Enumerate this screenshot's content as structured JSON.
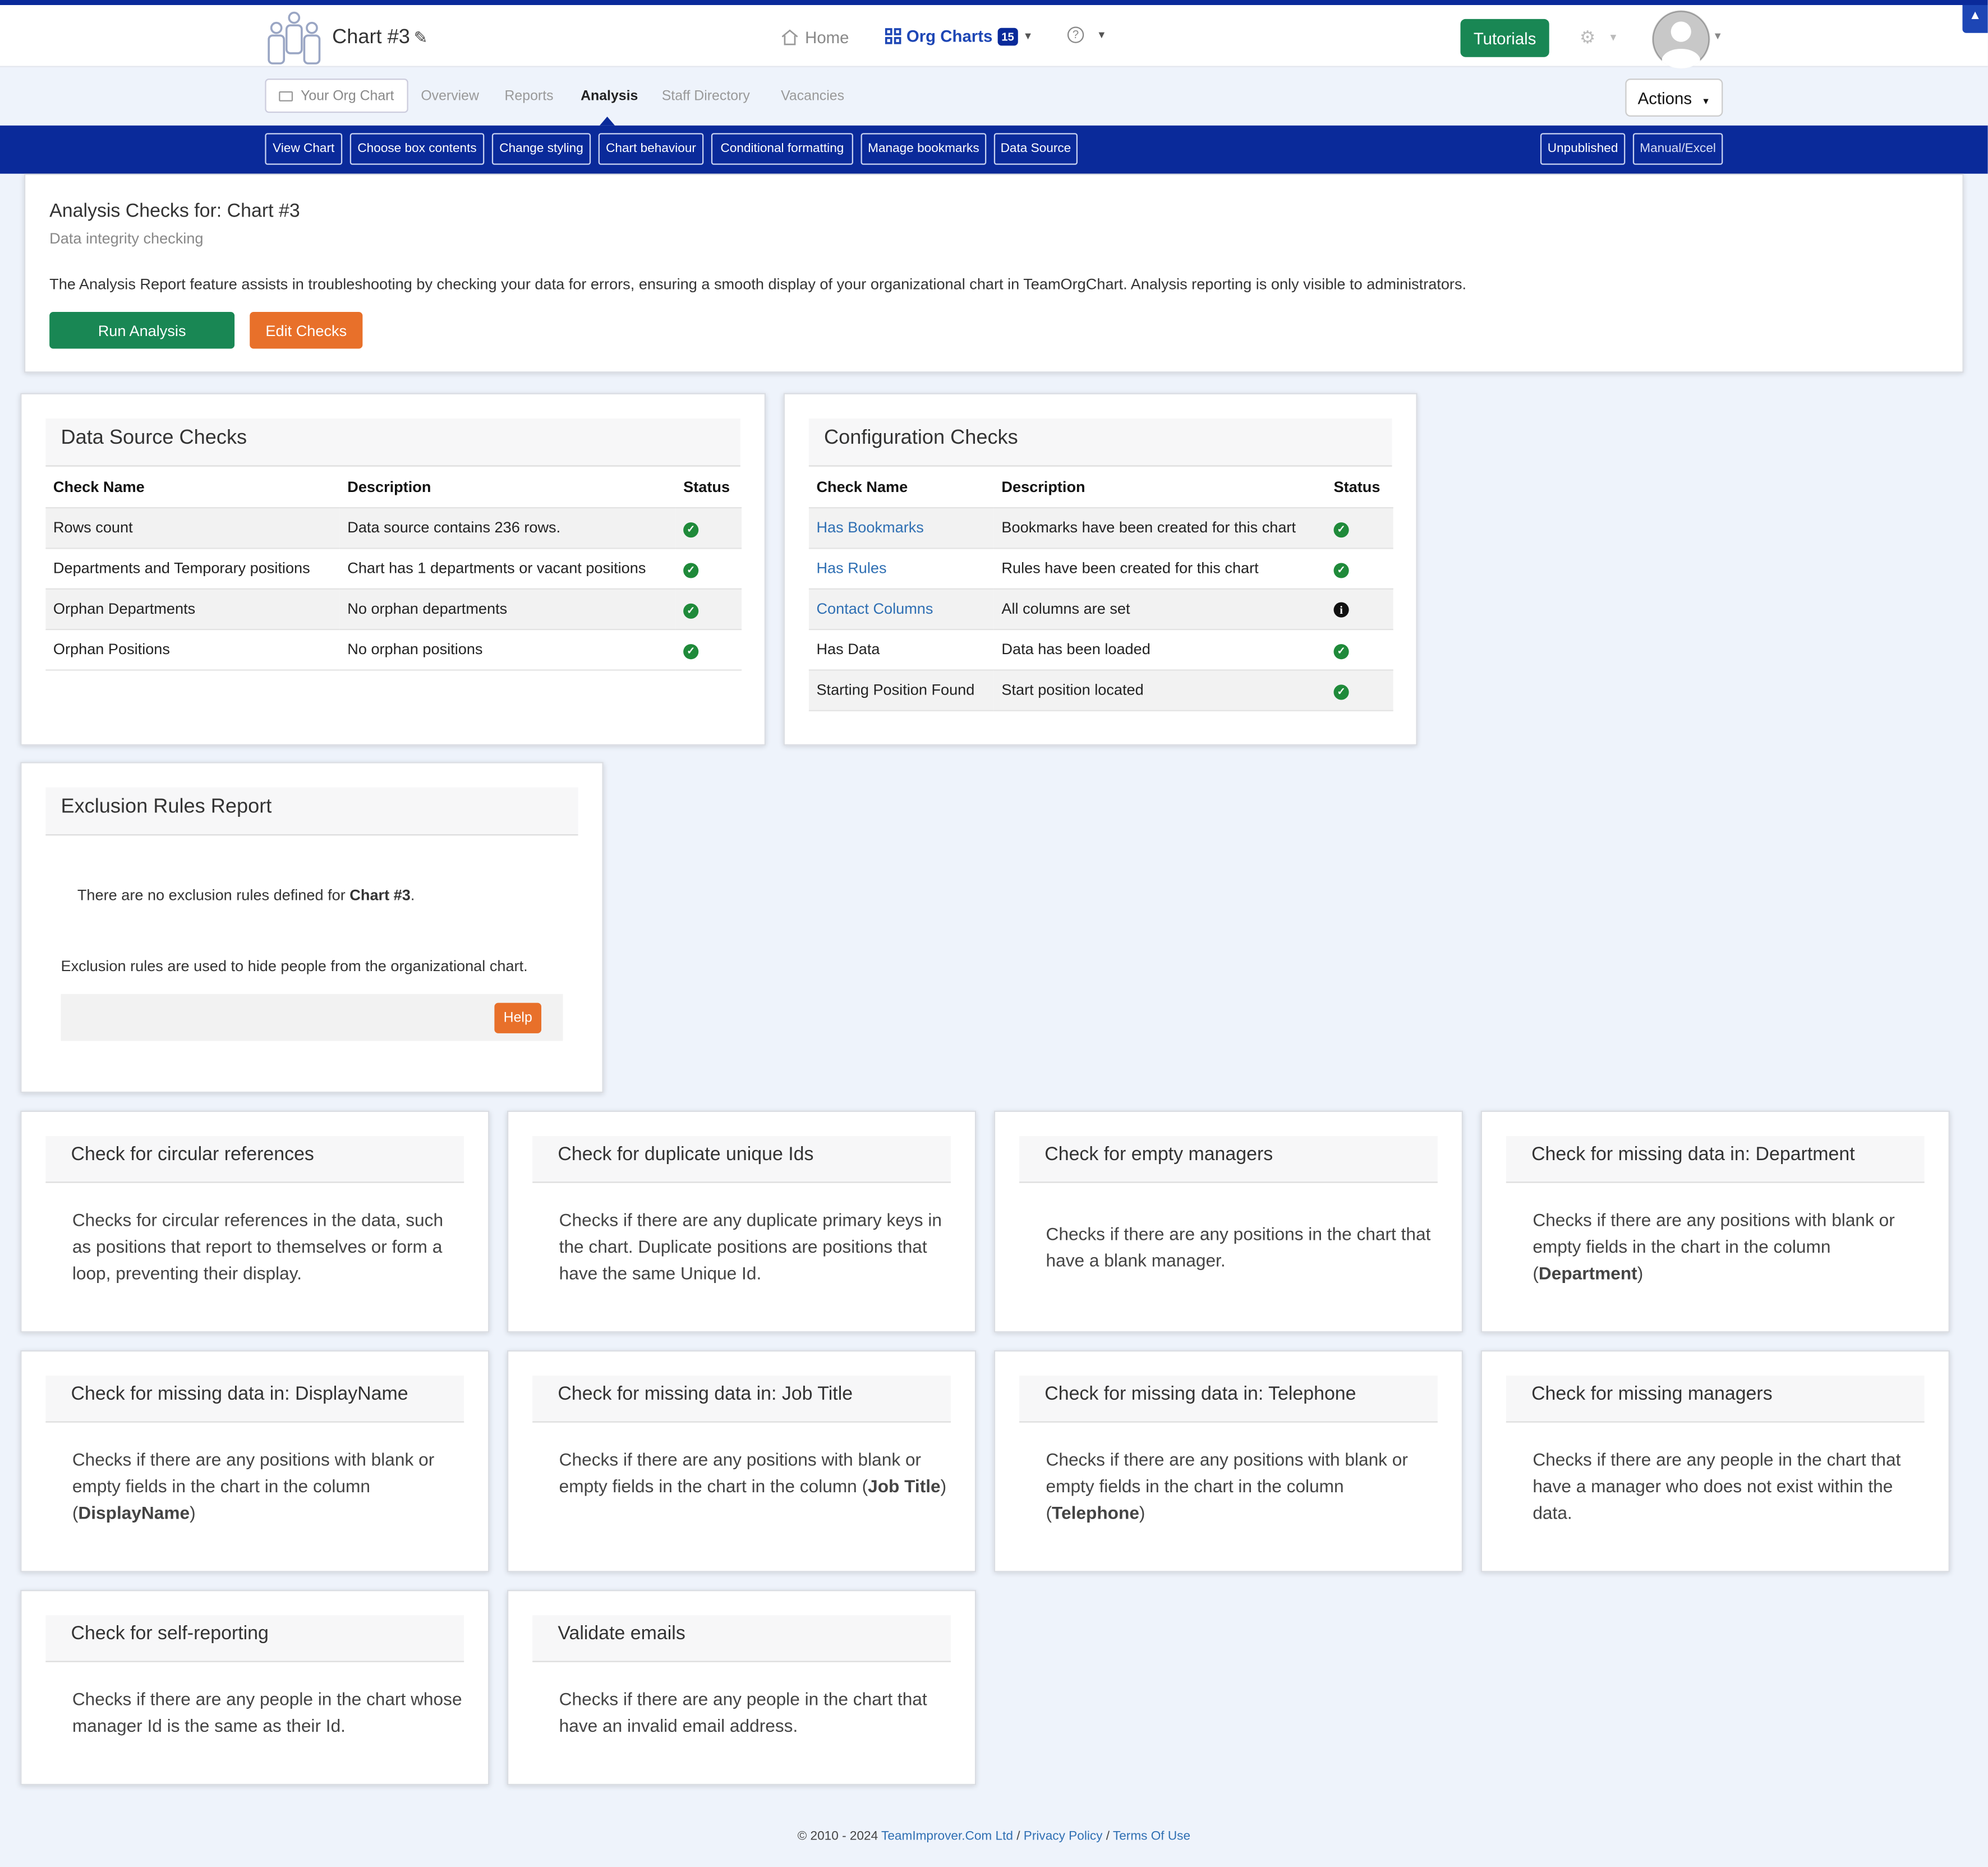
{
  "header": {
    "chart_title": "Chart #3",
    "nav": {
      "home": "Home",
      "org_charts": "Org Charts",
      "org_charts_count": "15"
    },
    "tutorials_label": "Tutorials"
  },
  "tabs": {
    "your_org_chart": "Your Org Chart",
    "items": [
      "Overview",
      "Reports",
      "Analysis",
      "Staff Directory",
      "Vacancies"
    ],
    "active": "Analysis",
    "actions_label": "Actions"
  },
  "toolbar": {
    "buttons": [
      "View Chart",
      "Choose box contents",
      "Change styling",
      "Chart behaviour",
      "Conditional formatting",
      "Manage bookmarks",
      "Data Source"
    ],
    "right_buttons": [
      "Unpublished",
      "Manual/Excel"
    ]
  },
  "intro": {
    "title": "Analysis Checks for: Chart #3",
    "subtitle": "Data integrity checking",
    "description": "The Analysis Report feature assists in troubleshooting by checking your data for errors, ensuring a smooth display of your organizational chart in TeamOrgChart. Analysis reporting is only visible to administrators.",
    "run_label": "Run Analysis",
    "edit_label": "Edit Checks"
  },
  "data_source": {
    "title": "Data Source Checks",
    "headers": [
      "Check Name",
      "Description",
      "Status"
    ],
    "rows": [
      {
        "name": "Rows count",
        "description": "Data source contains 236 rows.",
        "status": "ok"
      },
      {
        "name": "Departments and Temporary positions",
        "description": "Chart has 1 departments or vacant positions",
        "status": "ok"
      },
      {
        "name": "Orphan Departments",
        "description": "No orphan departments",
        "status": "ok"
      },
      {
        "name": "Orphan Positions",
        "description": "No orphan positions",
        "status": "ok"
      }
    ]
  },
  "configuration": {
    "title": "Configuration Checks",
    "headers": [
      "Check Name",
      "Description",
      "Status"
    ],
    "rows": [
      {
        "name": "Has Bookmarks",
        "description": "Bookmarks have been created for this chart",
        "status": "ok"
      },
      {
        "name": "Has Rules",
        "description": "Rules have been created for this chart",
        "status": "ok"
      },
      {
        "name": "Contact Columns",
        "description": "All columns are set",
        "status": "info"
      },
      {
        "name": "Has Data",
        "description": "Data has been loaded",
        "status": "ok"
      },
      {
        "name": "Starting Position Found",
        "description": "Start position located",
        "status": "ok"
      }
    ]
  },
  "exclusion": {
    "title": "Exclusion Rules Report",
    "line1_prefix": "There are no exclusion rules defined for ",
    "line1_bold": "Chart #3",
    "line1_suffix": ".",
    "line2": "Exclusion rules are used to hide people from the organizational chart.",
    "help_label": "Help"
  },
  "check_cards": [
    {
      "title": "Check for circular references",
      "body": "Checks for circular references in the data, such as positions that report to themselves or form a loop, preventing their display."
    },
    {
      "title": "Check for duplicate unique Ids",
      "body": "Checks if there are any duplicate primary keys in the chart. Duplicate positions are positions that have the same Unique Id."
    },
    {
      "title": "Check for empty managers",
      "body": "Checks if there are any positions in the chart that have a blank manager."
    },
    {
      "title": "Check for missing data in: Department",
      "body": "Checks if there are any positions with blank or empty fields in the chart in the column (",
      "bold": "Department",
      "suffix": ")"
    },
    {
      "title": "Check for missing data in: DisplayName",
      "body": "Checks if there are any positions with blank or empty fields in the chart in the column (",
      "bold": "DisplayName",
      "suffix": ")"
    },
    {
      "title": "Check for missing data in: Job Title",
      "body": "Checks if there are any positions with blank or empty fields in the chart in the column (",
      "bold": "Job Title",
      "suffix": ")"
    },
    {
      "title": "Check for missing data in: Telephone",
      "body": "Checks if there are any positions with blank or empty fields in the chart in the column (",
      "bold": "Telephone",
      "suffix": ")"
    },
    {
      "title": "Check for missing managers",
      "body": "Checks if there are any people in the chart that have a manager who does not exist within the data."
    },
    {
      "title": "Check for self-reporting",
      "body": "Checks if there are any people in the chart whose manager Id is the same as their Id."
    },
    {
      "title": "Validate emails",
      "body": "Checks if there are any people in the chart that have an invalid email address."
    }
  ],
  "footer": {
    "copyright": "© 2010 - 2024 ",
    "company": "TeamImprover.Com Ltd",
    "sep": " / ",
    "privacy": "Privacy Policy",
    "terms": "Terms Of Use"
  },
  "colors": {
    "brand_navy": "#0a2a9a",
    "success_green": "#198754",
    "orange": "#e8702a",
    "link_blue": "#2f6fb3",
    "page_bg": "#eef3fb"
  }
}
